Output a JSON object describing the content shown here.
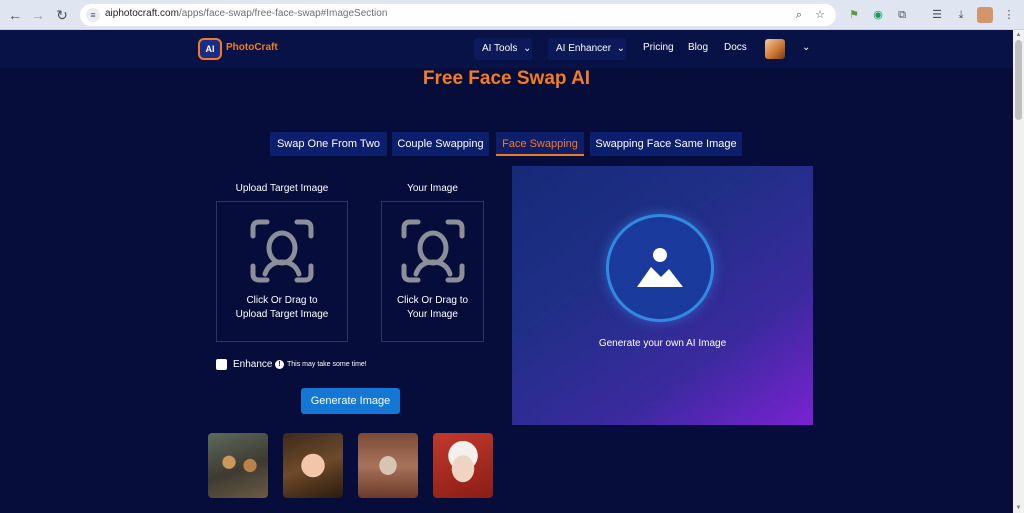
{
  "browser": {
    "url_domain": "aiphotocraft.com",
    "url_path": "/apps/face-swap/free-face-swap#ImageSection"
  },
  "header": {
    "logo_mark": "AI",
    "logo_text": "PhotoCraft",
    "nav": {
      "ai_tools": "AI Tools",
      "ai_enhancer": "AI Enhancer",
      "pricing": "Pricing",
      "blog": "Blog",
      "docs": "Docs"
    }
  },
  "page": {
    "title": "Free Face Swap AI",
    "tabs": [
      {
        "label": "Swap One From Two",
        "active": false
      },
      {
        "label": "Couple Swapping",
        "active": false
      },
      {
        "label": "Face Swapping",
        "active": true
      },
      {
        "label": "Swapping Face Same Image",
        "active": false
      }
    ],
    "upload_target": {
      "label": "Upload Target Image",
      "prompt_line1": "Click Or Drag to",
      "prompt_line2": "Upload Target Image"
    },
    "your_image": {
      "label": "Your Image",
      "prompt_line1": "Click Or Drag to",
      "prompt_line2": "Your Image"
    },
    "enhance": {
      "label": "Enhance",
      "checked": false,
      "note": "This may take some time!"
    },
    "generate_button": "Generate Image",
    "preview_text": "Generate your own AI Image"
  },
  "colors": {
    "accent": "#f47b20",
    "primary_button": "#1577d4",
    "background": "#060d3b"
  }
}
